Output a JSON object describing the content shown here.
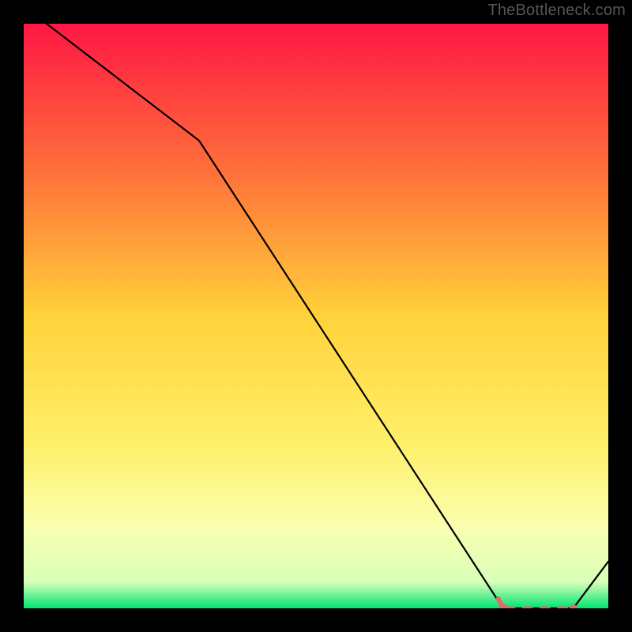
{
  "watermark": "TheBottleneck.com",
  "chart_data": {
    "type": "line",
    "title": "",
    "xlabel": "",
    "ylabel": "",
    "xlim": [
      0,
      100
    ],
    "ylim": [
      0,
      100
    ],
    "x": [
      0,
      30,
      82,
      94,
      100
    ],
    "values": [
      103,
      80,
      0,
      0,
      8
    ],
    "optimal_band": {
      "x_start": 82,
      "x_end": 94,
      "y": 0
    },
    "gradient_stops": [
      {
        "offset": 0.0,
        "color": "#ff1744"
      },
      {
        "offset": 0.25,
        "color": "#ff6f3a"
      },
      {
        "offset": 0.5,
        "color": "#ffd23a"
      },
      {
        "offset": 0.72,
        "color": "#fff06a"
      },
      {
        "offset": 0.86,
        "color": "#faffb0"
      },
      {
        "offset": 0.955,
        "color": "#d8ffb8"
      },
      {
        "offset": 1.0,
        "color": "#00e673"
      }
    ],
    "marker_color": "#e26a6a",
    "marker_points_x": [
      82,
      83.5,
      85,
      86.5,
      88,
      89.5,
      91,
      92.5,
      94
    ]
  }
}
